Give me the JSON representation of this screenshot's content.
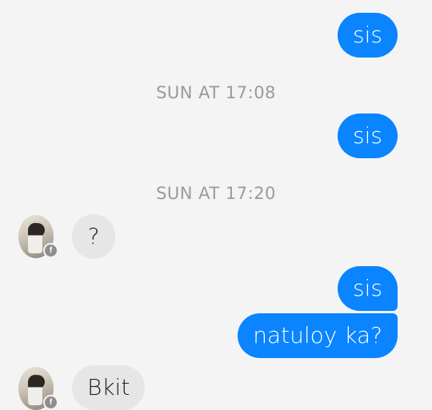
{
  "messages": {
    "m1": "sis",
    "ts1": "SUN AT 17:08",
    "m2": "sis",
    "ts2": "SUN AT 17:20",
    "m3": "?",
    "m4": "sis",
    "m5": "natuloy ka?",
    "m6": "Bkit"
  },
  "avatar": {
    "badge_icon": "facebook-icon",
    "badge_glyph": "f"
  },
  "colors": {
    "outgoing_bubble": "#0a84ff",
    "incoming_bubble": "#e6e6e6",
    "timestamp_text": "#9a9a9a",
    "background": "#f4f4f4"
  }
}
